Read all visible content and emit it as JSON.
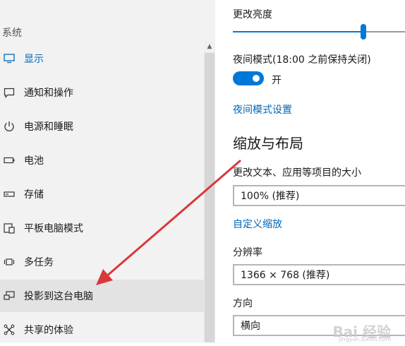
{
  "nav": {
    "header": "系统",
    "items": [
      {
        "label": "显示",
        "icon": "monitor-icon"
      },
      {
        "label": "通知和操作",
        "icon": "notification-icon"
      },
      {
        "label": "电源和睡眠",
        "icon": "power-icon"
      },
      {
        "label": "电池",
        "icon": "battery-icon"
      },
      {
        "label": "存储",
        "icon": "storage-icon"
      },
      {
        "label": "平板电脑模式",
        "icon": "tablet-mode-icon"
      },
      {
        "label": "多任务",
        "icon": "multitask-icon"
      },
      {
        "label": "投影到这台电脑",
        "icon": "project-icon"
      },
      {
        "label": "共享的体验",
        "icon": "shared-experience-icon"
      }
    ],
    "scroll_up_glyph": "▲"
  },
  "content": {
    "brightness_label": "更改亮度",
    "brightness_level_percent": 76,
    "night_mode_label": "夜间模式(18:00 之前保持关闭)",
    "night_mode_toggle_text": "开",
    "night_mode_settings_link": "夜间模式设置",
    "scale_section_title": "缩放与布局",
    "text_size_label": "更改文本、应用等项目的大小",
    "text_size_value": "100% (推荐)",
    "custom_scaling_link": "自定义缩放",
    "resolution_label": "分辨率",
    "resolution_value": "1366 × 768 (推荐)",
    "orientation_label": "方向",
    "orientation_value": "横向"
  },
  "watermark": {
    "text": "Bai 经验",
    "sub": "jingyan.baidu.com"
  },
  "colors": {
    "accent": "#0078d7",
    "link": "#0067b8",
    "arrow": "#d9383a",
    "nav_bg": "#f2f2f2"
  }
}
